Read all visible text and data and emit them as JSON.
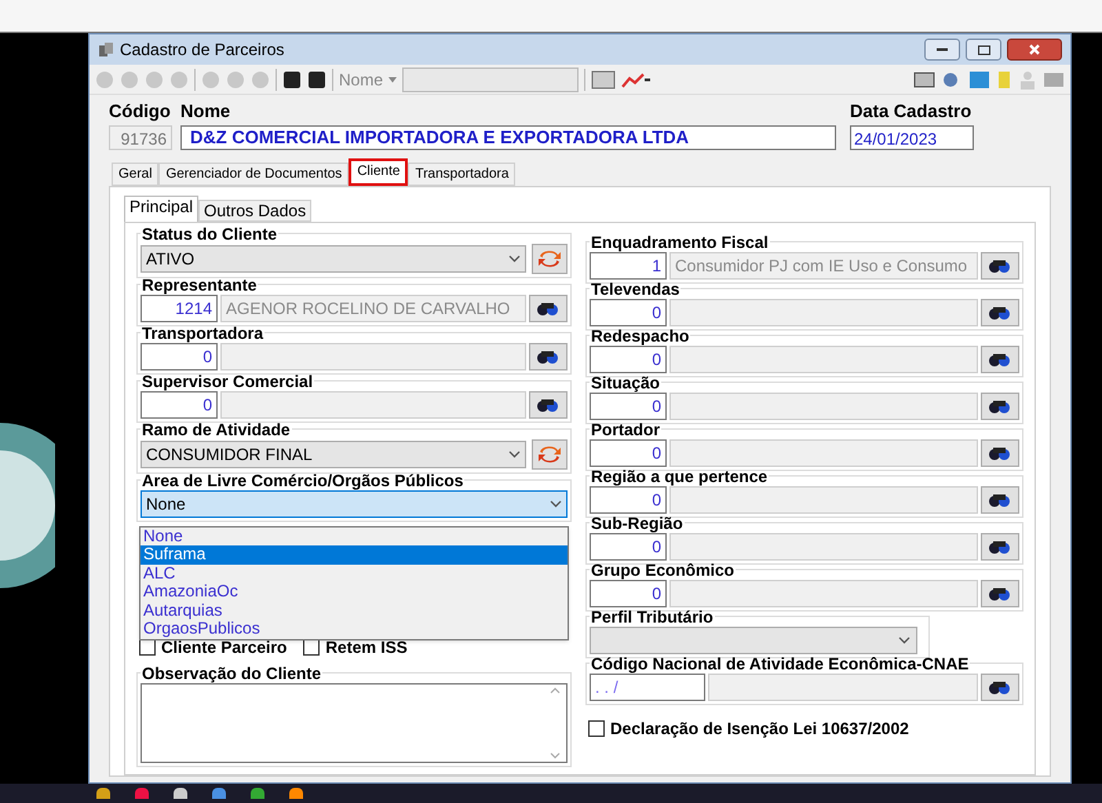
{
  "window": {
    "title": "Cadastro de Parceiros"
  },
  "toolbar": {
    "search_label": "Nome"
  },
  "header": {
    "codigo_label": "Código",
    "codigo": "91736",
    "nome_label": "Nome",
    "nome": "D&Z COMERCIAL IMPORTADORA E EXPORTADORA LTDA",
    "data_label": "Data Cadastro",
    "data": "24/01/2023"
  },
  "tabs": [
    {
      "label": "Geral",
      "selected": false
    },
    {
      "label": "Gerenciador de Documentos",
      "selected": false
    },
    {
      "label": "Cliente",
      "selected": true
    },
    {
      "label": "Transportadora",
      "selected": false
    }
  ],
  "subtabs": [
    {
      "label": "Principal",
      "selected": true
    },
    {
      "label": "Outros Dados",
      "selected": false
    }
  ],
  "left_groups": [
    {
      "kind": "combo",
      "label": "Status do Cliente",
      "value": "ATIVO"
    },
    {
      "kind": "lookup",
      "label": "Representante",
      "code": "1214",
      "description": "AGENOR ROCELINO DE CARVALHO"
    },
    {
      "kind": "lookup",
      "label": "Transportadora",
      "code": "0"
    },
    {
      "kind": "lookup",
      "label": "Supervisor Comercial",
      "code": "0"
    },
    {
      "kind": "combo",
      "label": "Ramo de Atividade",
      "value": "CONSUMIDOR FINAL"
    }
  ],
  "area": {
    "label": "Area de Livre Comércio/Orgãos Públicos",
    "value": "None",
    "options": [
      {
        "label": "None",
        "highlighted": false
      },
      {
        "label": "Suframa",
        "highlighted": true
      },
      {
        "label": "ALC",
        "highlighted": false
      },
      {
        "label": "AmazoniaOc",
        "highlighted": false
      },
      {
        "label": "Autarquias",
        "highlighted": false
      },
      {
        "label": "OrgaosPublicos",
        "highlighted": false
      }
    ]
  },
  "checkboxes": [
    {
      "label": "Cliente Parceiro",
      "checked": false
    },
    {
      "label": "Retem ISS",
      "checked": false
    }
  ],
  "observacao": {
    "label": "Observação do Cliente"
  },
  "right_groups": [
    {
      "kind": "lookup",
      "label": "Enquadramento Fiscal",
      "code": "1",
      "description": "Consumidor PJ com IE Uso e Consumo"
    },
    {
      "kind": "lookup",
      "label": "Televendas",
      "code": "0"
    },
    {
      "kind": "lookup",
      "label": "Redespacho",
      "code": "0"
    },
    {
      "kind": "lookup",
      "label": "Situação",
      "code": "0"
    },
    {
      "kind": "lookup",
      "label": "Portador",
      "code": "0"
    },
    {
      "kind": "lookup",
      "label": "Região a que pertence",
      "code": "0"
    },
    {
      "kind": "lookup",
      "label": "Sub-Região",
      "code": "0"
    },
    {
      "kind": "lookup",
      "label": "Grupo Econômico",
      "code": "0"
    },
    {
      "kind": "select",
      "label": "Perfil Tributário"
    },
    {
      "kind": "wide_lookup",
      "label": "Código Nacional de Atividade Econômica-CNAE",
      "code": ". . /"
    }
  ],
  "declaracao": {
    "label": "Declaração de Isenção Lei 10637/2002",
    "checked": false
  }
}
